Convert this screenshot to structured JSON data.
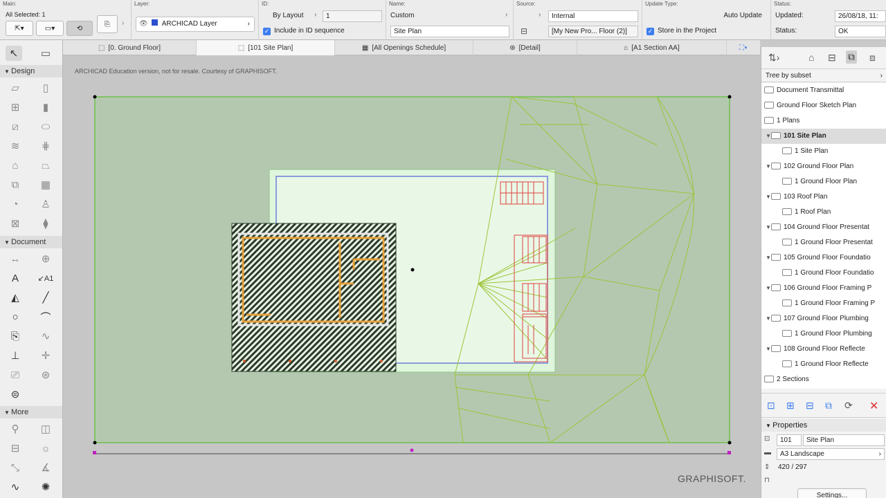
{
  "infobox": {
    "main_label": "Main:",
    "all_selected": "All Selected: 1",
    "layer_label": "Layer:",
    "layer_value": "ARCHICAD Layer",
    "id_label": "ID:",
    "id_mode": "By Layout",
    "id_value": "1",
    "include_in_id": "Include in ID sequence",
    "name_label": "Name:",
    "name_mode": "Custom",
    "name_value": "Site Plan",
    "source_label": "Source:",
    "source_value": "Internal",
    "source_view": "[My New Pro... Floor (2)]",
    "update_type_label": "Update Type:",
    "update_type_value": "Auto Update",
    "store_in_project": "Store in the Project",
    "status_label": "Status:",
    "updated_label": "Updated:",
    "updated_value": "26/08/18, 11:",
    "status_row_label": "Status:",
    "status_value": "OK"
  },
  "tabs": [
    {
      "label": "[0. Ground Floor]",
      "icon": "floor-plan-icon"
    },
    {
      "label": "[101 Site Plan]",
      "icon": "layout-icon"
    },
    {
      "label": "[All Openings Schedule]",
      "icon": "schedule-icon"
    },
    {
      "label": "[Detail]",
      "icon": "detail-icon"
    },
    {
      "label": "[A1 Section AA]",
      "icon": "section-icon"
    }
  ],
  "toolbox": {
    "design_label": "Design",
    "document_label": "Document",
    "more_label": "More"
  },
  "canvas": {
    "watermark": "ARCHICAD Education version, not for resale. Courtesy of GRAPHISOFT.",
    "brand": "GRAPHISOFT."
  },
  "navigator": {
    "tree_mode": "Tree by subset",
    "items": [
      {
        "label": "Document Transmittal",
        "indent": 0,
        "arrow": ""
      },
      {
        "label": "Ground Floor Sketch Plan",
        "indent": 0,
        "arrow": ""
      },
      {
        "label": "1 Plans",
        "indent": 0,
        "arrow": ""
      },
      {
        "label": "101 Site Plan",
        "indent": 1,
        "arrow": "▼",
        "selected": true
      },
      {
        "label": "1 Site Plan",
        "indent": 2,
        "arrow": ""
      },
      {
        "label": "102 Ground Floor Plan",
        "indent": 1,
        "arrow": "▼"
      },
      {
        "label": "1 Ground Floor Plan",
        "indent": 2,
        "arrow": ""
      },
      {
        "label": "103 Roof Plan",
        "indent": 1,
        "arrow": "▼"
      },
      {
        "label": "1 Roof Plan",
        "indent": 2,
        "arrow": ""
      },
      {
        "label": "104 Ground Floor Presentat",
        "indent": 1,
        "arrow": "▼"
      },
      {
        "label": "1 Ground Floor Presentat",
        "indent": 2,
        "arrow": ""
      },
      {
        "label": "105 Ground Floor Foundatio",
        "indent": 1,
        "arrow": "▼"
      },
      {
        "label": "1 Ground Floor Foundatio",
        "indent": 2,
        "arrow": ""
      },
      {
        "label": "106 Ground Floor Framing P",
        "indent": 1,
        "arrow": "▼"
      },
      {
        "label": "1 Ground Floor Framing P",
        "indent": 2,
        "arrow": ""
      },
      {
        "label": "107 Ground Floor Plumbing",
        "indent": 1,
        "arrow": "▼"
      },
      {
        "label": "1 Ground Floor Plumbing",
        "indent": 2,
        "arrow": ""
      },
      {
        "label": "108 Ground Floor Reflecte",
        "indent": 1,
        "arrow": "▼"
      },
      {
        "label": "1 Ground Floor Reflecte",
        "indent": 2,
        "arrow": ""
      },
      {
        "label": "2 Sections",
        "indent": 0,
        "arrow": ""
      }
    ],
    "properties_label": "Properties",
    "prop_id": "101",
    "prop_name": "Site Plan",
    "prop_master": "A3 Landscape",
    "prop_size": "420 / 297",
    "settings_label": "Settings..."
  },
  "colors": {
    "layout_green": "#b4c8b0",
    "sheet_green": "#dff5dc",
    "hatch_dark": "#2b3a2b",
    "wall_orange": "#e6a13c",
    "contour_green": "#9cc43a",
    "stair_red": "#e04040",
    "frame_blue": "#6b7fd8"
  }
}
